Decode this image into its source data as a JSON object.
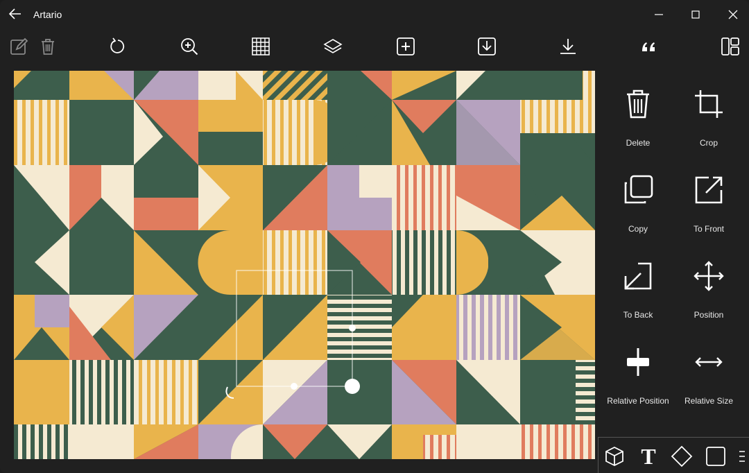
{
  "window": {
    "title": "Artario"
  },
  "panel": {
    "items": [
      {
        "label": "Delete",
        "icon": "trash-icon"
      },
      {
        "label": "Crop",
        "icon": "crop-icon"
      },
      {
        "label": "Copy",
        "icon": "copy-icon"
      },
      {
        "label": "To Front",
        "icon": "to-front-icon"
      },
      {
        "label": "To Back",
        "icon": "to-back-icon"
      },
      {
        "label": "Position",
        "icon": "move-arrows-icon"
      },
      {
        "label": "Relative Position",
        "icon": "relative-position-icon"
      },
      {
        "label": "Relative Size",
        "icon": "relative-size-icon"
      }
    ]
  },
  "bottom": {
    "text_tool_glyph": "T"
  },
  "colors": {
    "green": "#3d5e4c",
    "cream": "#f5ead2",
    "yellow": "#e9b44c",
    "coral": "#e07c5e",
    "lavender": "#b6a2bf"
  }
}
